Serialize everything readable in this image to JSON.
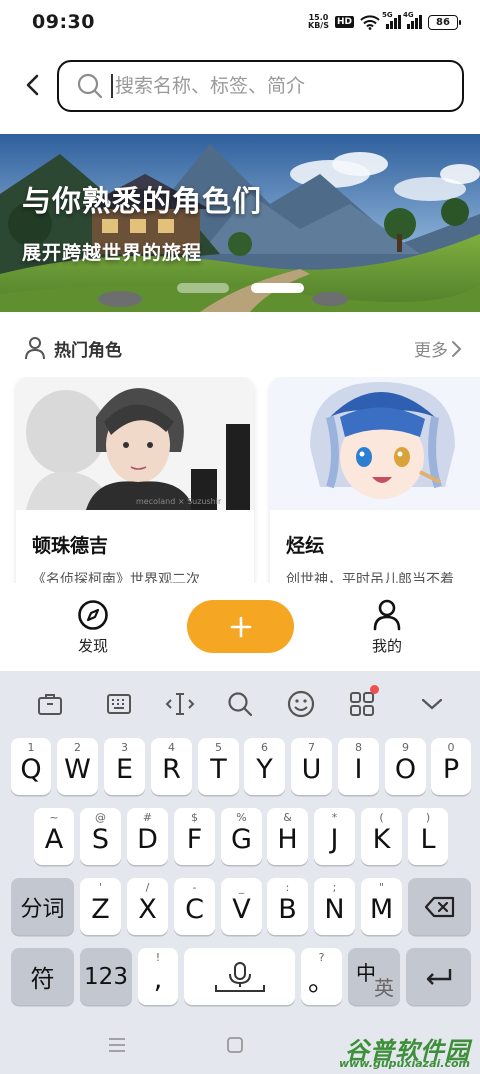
{
  "status_bar": {
    "time": "09:30",
    "net_speed_value": "15.0",
    "net_speed_unit": "KB/S",
    "hd_badge": "HD",
    "signal_1_label": "5G",
    "signal_2_label": "4G",
    "battery": "86"
  },
  "search": {
    "placeholder": "搜索名称、标签、简介",
    "back_icon": "chevron-left-icon",
    "search_icon": "search-icon"
  },
  "banner": {
    "title": "与你熟悉的角色们",
    "subtitle": "展开跨越世界的旅程",
    "active_slide": 2,
    "slide_count": 2
  },
  "hot_section": {
    "icon": "person-icon",
    "title": "热门角色",
    "more": "更多",
    "more_icon": "chevron-right-icon"
  },
  "cards": [
    {
      "name": "顿珠德吉",
      "desc": "《名侦探柯南》世界观二次",
      "watermark": "mecoland × Suzushir"
    },
    {
      "name": "烃纭",
      "desc": "创世神，平时吊儿郎当不着"
    }
  ],
  "bottom_nav": {
    "discover": "发现",
    "add": "+",
    "me": "我的"
  },
  "keyboard": {
    "toolbar": [
      "briefcase-icon",
      "keyboard-icon",
      "cursor-icon",
      "search-icon",
      "emoji-icon",
      "apps-icon",
      "chevron-down-icon"
    ],
    "row1": [
      {
        "hint": "1",
        "key": "Q"
      },
      {
        "hint": "2",
        "key": "W"
      },
      {
        "hint": "3",
        "key": "E"
      },
      {
        "hint": "4",
        "key": "R"
      },
      {
        "hint": "5",
        "key": "T"
      },
      {
        "hint": "6",
        "key": "Y"
      },
      {
        "hint": "7",
        "key": "U"
      },
      {
        "hint": "8",
        "key": "I"
      },
      {
        "hint": "9",
        "key": "O"
      },
      {
        "hint": "0",
        "key": "P"
      }
    ],
    "row2": [
      {
        "hint": "~",
        "key": "A"
      },
      {
        "hint": "@",
        "key": "S"
      },
      {
        "hint": "#",
        "key": "D"
      },
      {
        "hint": "$",
        "key": "F"
      },
      {
        "hint": "%",
        "key": "G"
      },
      {
        "hint": "&",
        "key": "H"
      },
      {
        "hint": "*",
        "key": "J"
      },
      {
        "hint": "(",
        "key": "K"
      },
      {
        "hint": ")",
        "key": "L"
      }
    ],
    "row3": [
      {
        "hint": "'",
        "key": "Z"
      },
      {
        "hint": "/",
        "key": "X"
      },
      {
        "hint": "-",
        "key": "C"
      },
      {
        "hint": "_",
        "key": "V"
      },
      {
        "hint": ":",
        "key": "B"
      },
      {
        "hint": ";",
        "key": "N"
      },
      {
        "hint": "\"",
        "key": "M"
      }
    ],
    "fenci": "分词",
    "backspace_icon": "backspace-icon",
    "row4": {
      "fu": "符",
      "num": "123",
      "comma_hint": "!",
      "comma": ",",
      "mic_icon": "microphone-icon",
      "period_hint": "?",
      "period": "。",
      "lang_zh": "中",
      "lang_en": "英",
      "enter_icon": "enter-icon"
    }
  },
  "system_nav": {
    "menu_icon": "menu-icon",
    "home_icon": "home-square-icon"
  },
  "watermark": {
    "main": "谷普软件园",
    "url": "www.gupuxiazai.com"
  }
}
